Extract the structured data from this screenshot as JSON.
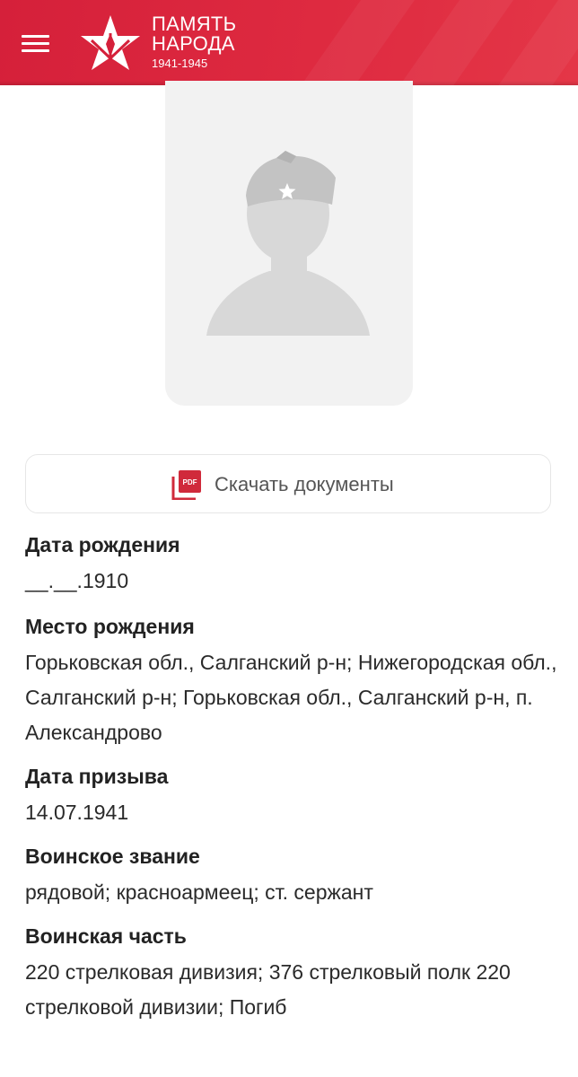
{
  "header": {
    "logo_line1": "ПАМЯТЬ",
    "logo_line2": "НАРОДА",
    "logo_years": "1941-1945",
    "brand_color": "#d5203a"
  },
  "icons": {
    "menu": "hamburger-menu-icon",
    "logo": "star-logo-icon",
    "pdf": "pdf-icon",
    "avatar": "soldier-placeholder-icon"
  },
  "download": {
    "label": "Скачать документы",
    "icon_color": "#d02a3b"
  },
  "sections": [
    {
      "title": "Дата рождения",
      "value": "__.__.1910"
    },
    {
      "title": "Место рождения",
      "value": "Горьковская обл., Салганский р-н; Нижегородская обл., Салганский р-н; Горьковская обл., Салганский р-н, п. Александрово"
    },
    {
      "title": "Дата призыва",
      "value": "14.07.1941"
    },
    {
      "title": "Воинское звание",
      "value": "рядовой; красноармеец; ст. сержант"
    },
    {
      "title": "Воинская часть",
      "value": "220 стрелковая дивизия; 376 стрелковый полк 220 стрелковой дивизии; Погиб"
    }
  ]
}
